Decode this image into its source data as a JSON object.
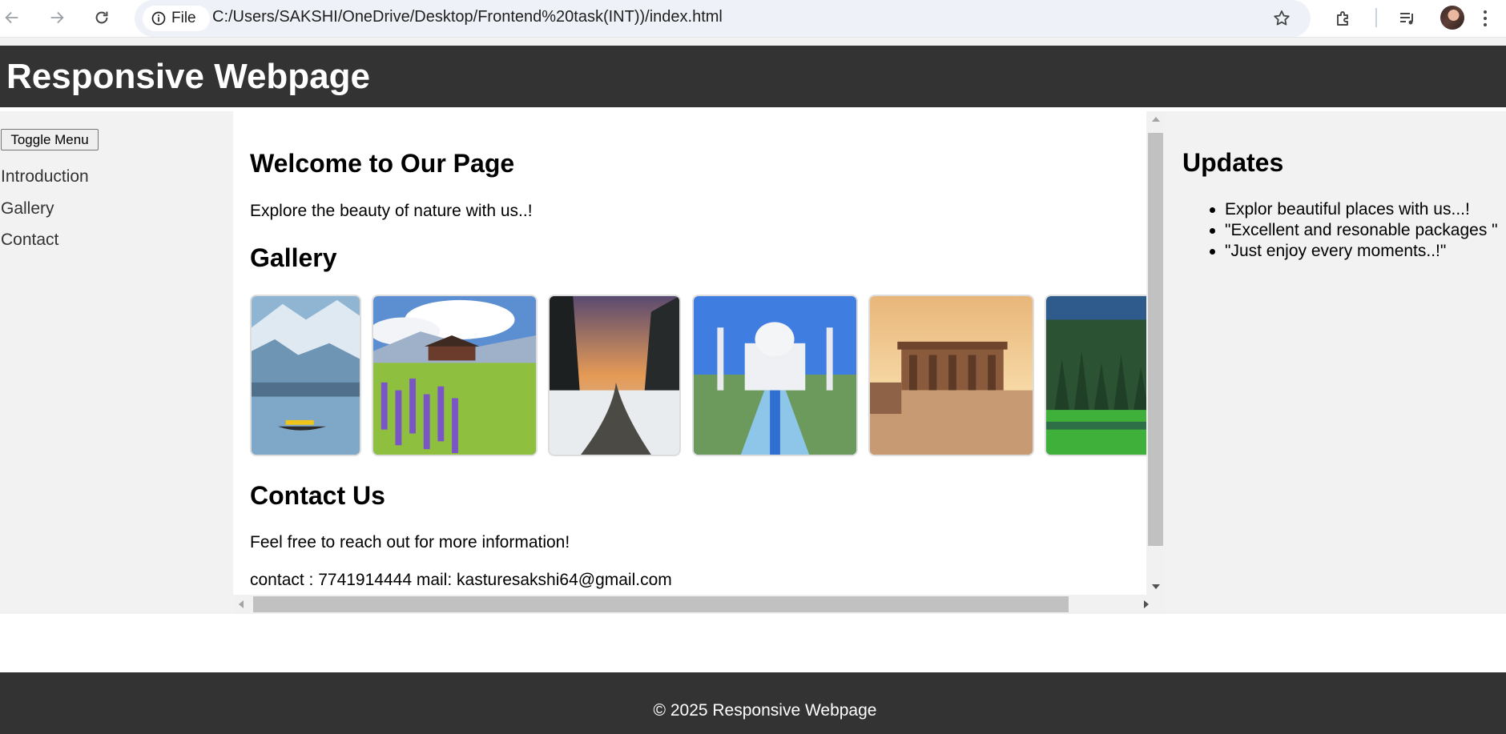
{
  "browser": {
    "site_chip_label": "File",
    "url": "C:/Users/SAKSHI/OneDrive/Desktop/Frontend%20task(INT))/index.html",
    "icons": [
      "back-arrow-icon",
      "forward-arrow-icon",
      "reload-icon",
      "info-icon",
      "star-icon",
      "extensions-icon",
      "media-queue-icon",
      "profile-avatar",
      "more-menu-icon"
    ]
  },
  "header": {
    "title": "Responsive Webpage"
  },
  "sidebar": {
    "toggle_label": "Toggle Menu",
    "links": [
      {
        "label": "Introduction"
      },
      {
        "label": "Gallery"
      },
      {
        "label": "Contact"
      }
    ]
  },
  "main": {
    "welcome_heading": "Welcome to Our Page",
    "welcome_text": "Explore the beauty of nature with us..!",
    "gallery_heading": "Gallery",
    "gallery_images": [
      {
        "subject": "snowy mountain lake with shikara boat"
      },
      {
        "subject": "alpine meadow with purple lupins and cottages"
      },
      {
        "subject": "snowy stream in pine forest at sunset"
      },
      {
        "subject": "Taj Mahal with reflecting pool"
      },
      {
        "subject": "ancient stone temple ruins at sunset"
      },
      {
        "subject": "green pine forest valley meadow"
      }
    ],
    "contact_heading": "Contact Us",
    "contact_text": "Feel free to reach out for more information!",
    "contact_details": "contact : 7741914444 mail: kasturesakshi64@gmail.com"
  },
  "updates": {
    "heading": "Updates",
    "items": [
      "Explor beautiful places with us...!",
      "\"Excellent and resonable packages \"",
      "\"Just enjoy every moments..!\""
    ]
  },
  "footer": {
    "copyright": "© 2025 Responsive Webpage"
  },
  "colors": {
    "header_bg": "#333333",
    "sidebar_bg": "#f2f2f2",
    "omnibox_bg": "#eef1f7"
  }
}
